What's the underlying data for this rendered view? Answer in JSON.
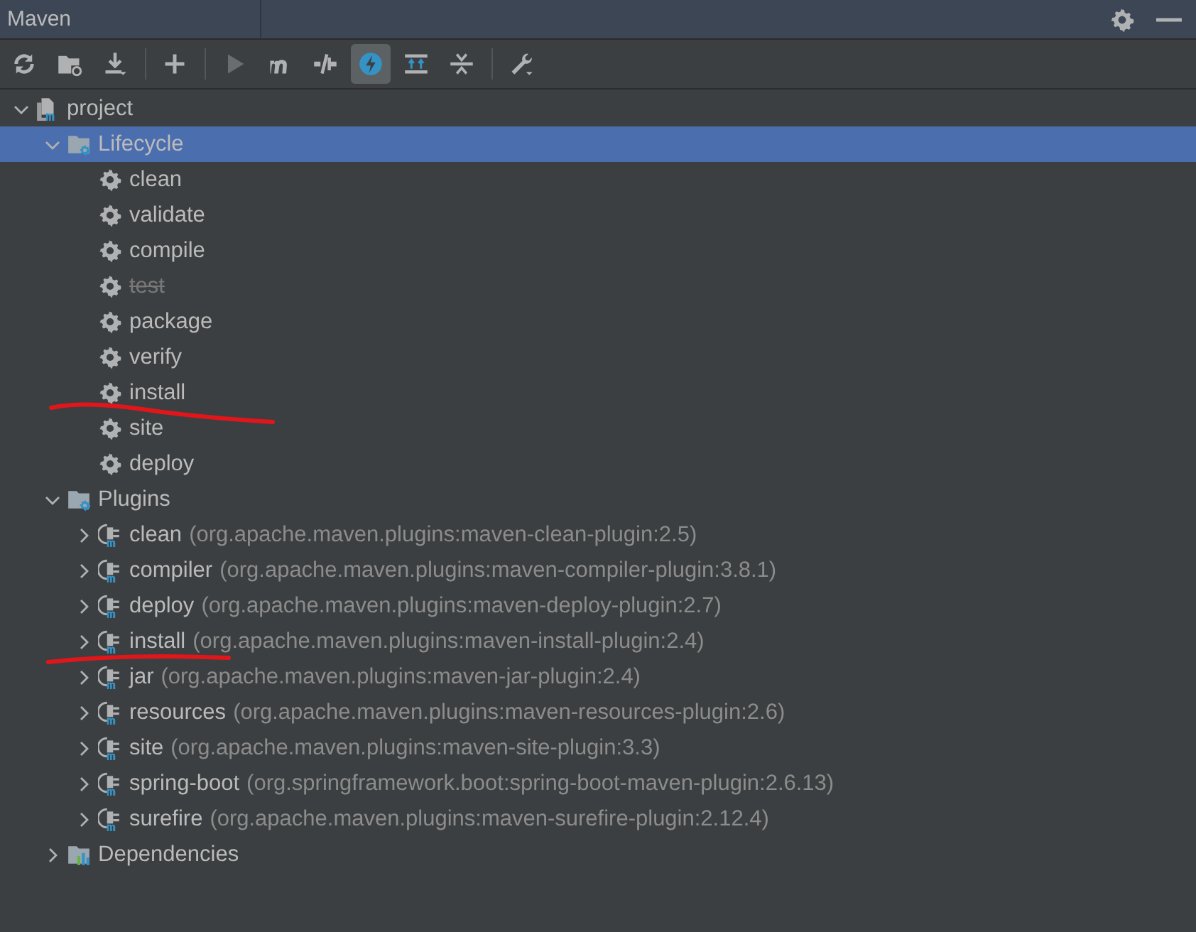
{
  "window": {
    "title": "Maven"
  },
  "toolbar": [
    {
      "kind": "reload",
      "disabled": false,
      "selected": false
    },
    {
      "kind": "add-folder",
      "disabled": false,
      "selected": false
    },
    {
      "kind": "download",
      "disabled": false,
      "selected": false
    },
    {
      "kind": "separator"
    },
    {
      "kind": "add",
      "disabled": false,
      "selected": false
    },
    {
      "kind": "separator"
    },
    {
      "kind": "run",
      "disabled": true,
      "selected": false
    },
    {
      "kind": "maven",
      "disabled": false,
      "selected": false
    },
    {
      "kind": "skip",
      "disabled": false,
      "selected": false
    },
    {
      "kind": "offline",
      "disabled": false,
      "selected": true
    },
    {
      "kind": "expand",
      "disabled": false,
      "selected": false
    },
    {
      "kind": "collapse",
      "disabled": false,
      "selected": false
    },
    {
      "kind": "separator"
    },
    {
      "kind": "settings",
      "disabled": false,
      "selected": false
    }
  ],
  "tree": [
    {
      "kind": "project",
      "label": "project",
      "expanded": true,
      "selected": false,
      "children": [
        {
          "kind": "folder",
          "label": "Lifecycle",
          "expanded": true,
          "selected": true,
          "children": [
            {
              "kind": "goal",
              "label": "clean",
              "skipped": false,
              "selected": false
            },
            {
              "kind": "goal",
              "label": "validate",
              "skipped": false,
              "selected": false
            },
            {
              "kind": "goal",
              "label": "compile",
              "skipped": false,
              "selected": false
            },
            {
              "kind": "goal",
              "label": "test",
              "skipped": true,
              "selected": false
            },
            {
              "kind": "goal",
              "label": "package",
              "skipped": false,
              "selected": false
            },
            {
              "kind": "goal",
              "label": "verify",
              "skipped": false,
              "selected": false
            },
            {
              "kind": "goal",
              "label": "install",
              "skipped": false,
              "selected": false
            },
            {
              "kind": "goal",
              "label": "site",
              "skipped": false,
              "selected": false
            },
            {
              "kind": "goal",
              "label": "deploy",
              "skipped": false,
              "selected": false
            }
          ]
        },
        {
          "kind": "folder",
          "label": "Plugins",
          "expanded": true,
          "selected": false,
          "children": [
            {
              "kind": "plugin",
              "label": "clean",
              "detail": "(org.apache.maven.plugins:maven-clean-plugin:2.5)",
              "expanded": false,
              "selected": false
            },
            {
              "kind": "plugin",
              "label": "compiler",
              "detail": "(org.apache.maven.plugins:maven-compiler-plugin:3.8.1)",
              "expanded": false,
              "selected": false
            },
            {
              "kind": "plugin",
              "label": "deploy",
              "detail": "(org.apache.maven.plugins:maven-deploy-plugin:2.7)",
              "expanded": false,
              "selected": false
            },
            {
              "kind": "plugin",
              "label": "install",
              "detail": "(org.apache.maven.plugins:maven-install-plugin:2.4)",
              "expanded": false,
              "selected": false
            },
            {
              "kind": "plugin",
              "label": "jar",
              "detail": "(org.apache.maven.plugins:maven-jar-plugin:2.4)",
              "expanded": false,
              "selected": false
            },
            {
              "kind": "plugin",
              "label": "resources",
              "detail": "(org.apache.maven.plugins:maven-resources-plugin:2.6)",
              "expanded": false,
              "selected": false
            },
            {
              "kind": "plugin",
              "label": "site",
              "detail": "(org.apache.maven.plugins:maven-site-plugin:3.3)",
              "expanded": false,
              "selected": false
            },
            {
              "kind": "plugin",
              "label": "spring-boot",
              "detail": "(org.springframework.boot:spring-boot-maven-plugin:2.6.13)",
              "expanded": false,
              "selected": false
            },
            {
              "kind": "plugin",
              "label": "surefire",
              "detail": "(org.apache.maven.plugins:maven-surefire-plugin:2.12.4)",
              "expanded": false,
              "selected": false
            }
          ]
        },
        {
          "kind": "dependencies",
          "label": "Dependencies",
          "expanded": false,
          "selected": false
        }
      ]
    }
  ]
}
